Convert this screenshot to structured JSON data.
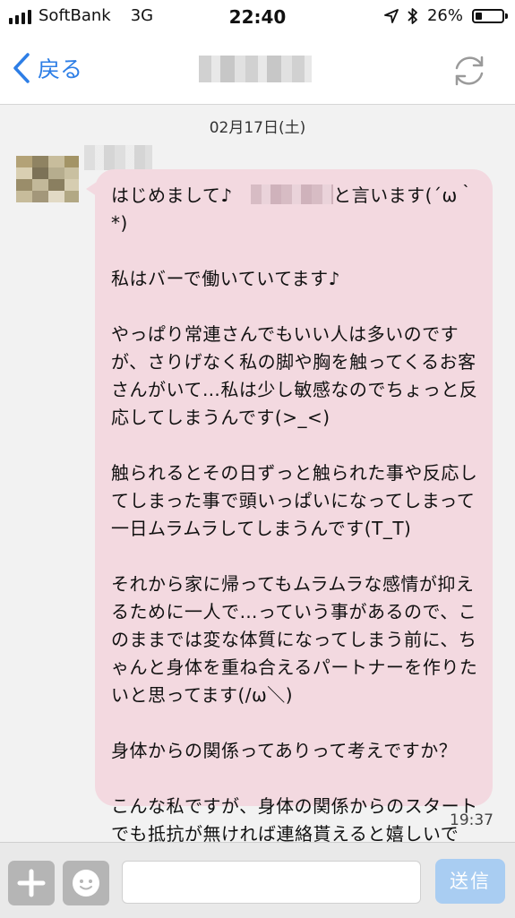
{
  "status_bar": {
    "carrier": "SoftBank",
    "network": "3G",
    "time": "22:40",
    "battery": "26%",
    "battery_level": 0.26
  },
  "nav": {
    "back_label": "戻る",
    "back_icon": "chevron-left-icon",
    "refresh_icon": "refresh-icon",
    "accent_color": "#2d7ee6"
  },
  "chat": {
    "date": "02月17日(土)",
    "message": {
      "greeting_before": "はじめまして♪　",
      "greeting_after": "と言います(´ω｀*)",
      "body": "私はバーで働いていてます♪\n\nやっぱり常連さんでもいい人は多いのですが、さりげなく私の脚や胸を触ってくるお客さんがいて…私は少し敏感なのでちょっと反応してしまうんです(>_<)\n\n触られるとその日ずっと触られた事や反応してしまった事で頭いっぱいになってしまって一日ムラムラしてしまうんです(T_T)\n\nそれから家に帰ってもムラムラな感情が抑えるために一人で…っていう事があるので、このままでは変な体質になってしまう前に、ちゃんと身体を重ね合えるパートナーを作りたいと思ってます(/ω＼)\n\n身体からの関係ってありって考えですか？\n\nこんな私ですが、身体の関係からのスタートでも抵抗が無ければ連絡貰えると嬉しいです！",
      "time": "19:37",
      "bubble_color": "#f3d9e0"
    }
  },
  "input_bar": {
    "plus_icon": "plus-icon",
    "sticker_icon": "smiley-icon",
    "send_label": "送信",
    "send_color": "#a9cdf2"
  }
}
